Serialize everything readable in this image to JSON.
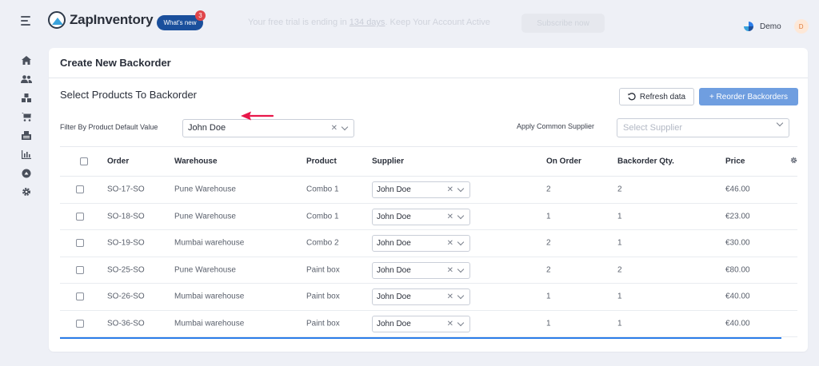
{
  "header": {
    "app_name": "ZapInventory",
    "whats_new_label": "What's new",
    "whats_new_count": "3",
    "trial_prefix": "Your free trial is ending in ",
    "trial_days": "134 days",
    "trial_suffix": ". Keep Your Account Active",
    "subscribe_label": "Subscribe now",
    "user_name": "Demo",
    "user_initial": "D"
  },
  "sidebar": {
    "items": [
      {
        "icon": "home-icon"
      },
      {
        "icon": "users-icon"
      },
      {
        "icon": "inventory-icon"
      },
      {
        "icon": "cart-icon"
      },
      {
        "icon": "purchase-icon"
      },
      {
        "icon": "reports-icon"
      },
      {
        "icon": "integrations-icon"
      },
      {
        "icon": "settings-icon"
      }
    ]
  },
  "page": {
    "title": "Create New Backorder",
    "section_title": "Select Products To Backorder",
    "refresh_label": "Refresh data",
    "reorder_label": "+ Reorder Backorders",
    "filter_label": "Filter By Product Default Value",
    "filter_value": "John Doe",
    "supplier_label": "Apply Common Supplier",
    "supplier_placeholder": "Select Supplier"
  },
  "table": {
    "columns": [
      "Order",
      "Warehouse",
      "Product",
      "Supplier",
      "On Order",
      "Backorder Qty.",
      "Price"
    ],
    "rows": [
      {
        "order": "SO-17-SO",
        "warehouse": "Pune Warehouse",
        "product": "Combo 1",
        "supplier": "John Doe",
        "on_order": "2",
        "backorder_qty": "2",
        "price": "€46.00"
      },
      {
        "order": "SO-18-SO",
        "warehouse": "Pune Warehouse",
        "product": "Combo 1",
        "supplier": "John Doe",
        "on_order": "1",
        "backorder_qty": "1",
        "price": "€23.00"
      },
      {
        "order": "SO-19-SO",
        "warehouse": "Mumbai warehouse",
        "product": "Combo 2",
        "supplier": "John Doe",
        "on_order": "2",
        "backorder_qty": "1",
        "price": "€30.00"
      },
      {
        "order": "SO-25-SO",
        "warehouse": "Pune Warehouse",
        "product": "Paint box",
        "supplier": "John Doe",
        "on_order": "2",
        "backorder_qty": "2",
        "price": "€80.00"
      },
      {
        "order": "SO-26-SO",
        "warehouse": "Mumbai warehouse",
        "product": "Paint box",
        "supplier": "John Doe",
        "on_order": "1",
        "backorder_qty": "1",
        "price": "€40.00"
      },
      {
        "order": "SO-36-SO",
        "warehouse": "Mumbai warehouse",
        "product": "Paint box",
        "supplier": "John Doe",
        "on_order": "1",
        "backorder_qty": "1",
        "price": "€40.00"
      }
    ]
  },
  "colors": {
    "accent": "#2b7de9",
    "reorder_button": "#6f9ee0",
    "annotation_arrow": "#e8174a"
  }
}
